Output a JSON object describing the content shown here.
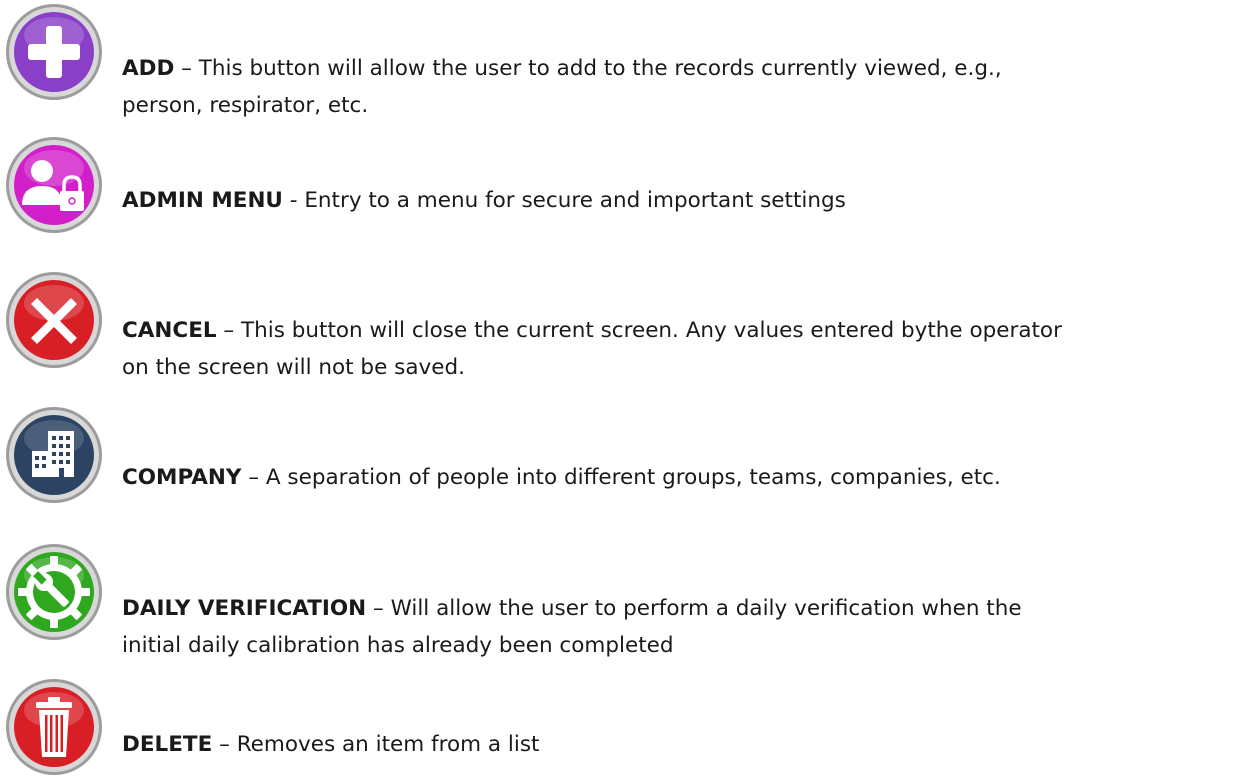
{
  "entries": [
    {
      "icon": "plus-icon",
      "color": "#8a3fc8",
      "term": "ADD",
      "separator": " – ",
      "line1": "This button will allow the user to add to the records currently viewed, e.g.,",
      "line2": "person, respirator, etc."
    },
    {
      "icon": "admin-lock-icon",
      "color": "#d21fc9",
      "term": "ADMIN MENU",
      "separator": " - ",
      "line1": "Entry to a menu for secure and important settings",
      "line2": ""
    },
    {
      "icon": "close-x-icon",
      "color": "#d81f26",
      "term": "CANCEL",
      "separator": " – ",
      "line1": "This button will close the current screen. Any values entered bythe operator",
      "line2": "on the screen will not be saved."
    },
    {
      "icon": "building-icon",
      "color": "#2d4363",
      "term": "COMPANY",
      "separator": " – ",
      "line1": "A separation of people into different groups, teams, companies, etc.",
      "line2": ""
    },
    {
      "icon": "gear-wrench-icon",
      "color": "#2fa81f",
      "term": "DAILY VERIFICATION",
      "separator": " – ",
      "line1": "Will allow the user to perform a daily verification when the",
      "line2": "initial daily calibration has already been completed"
    },
    {
      "icon": "trash-icon",
      "color": "#d81f26",
      "term": "DELETE",
      "separator": " – ",
      "line1": "Removes an item from a list",
      "line2": ""
    }
  ]
}
